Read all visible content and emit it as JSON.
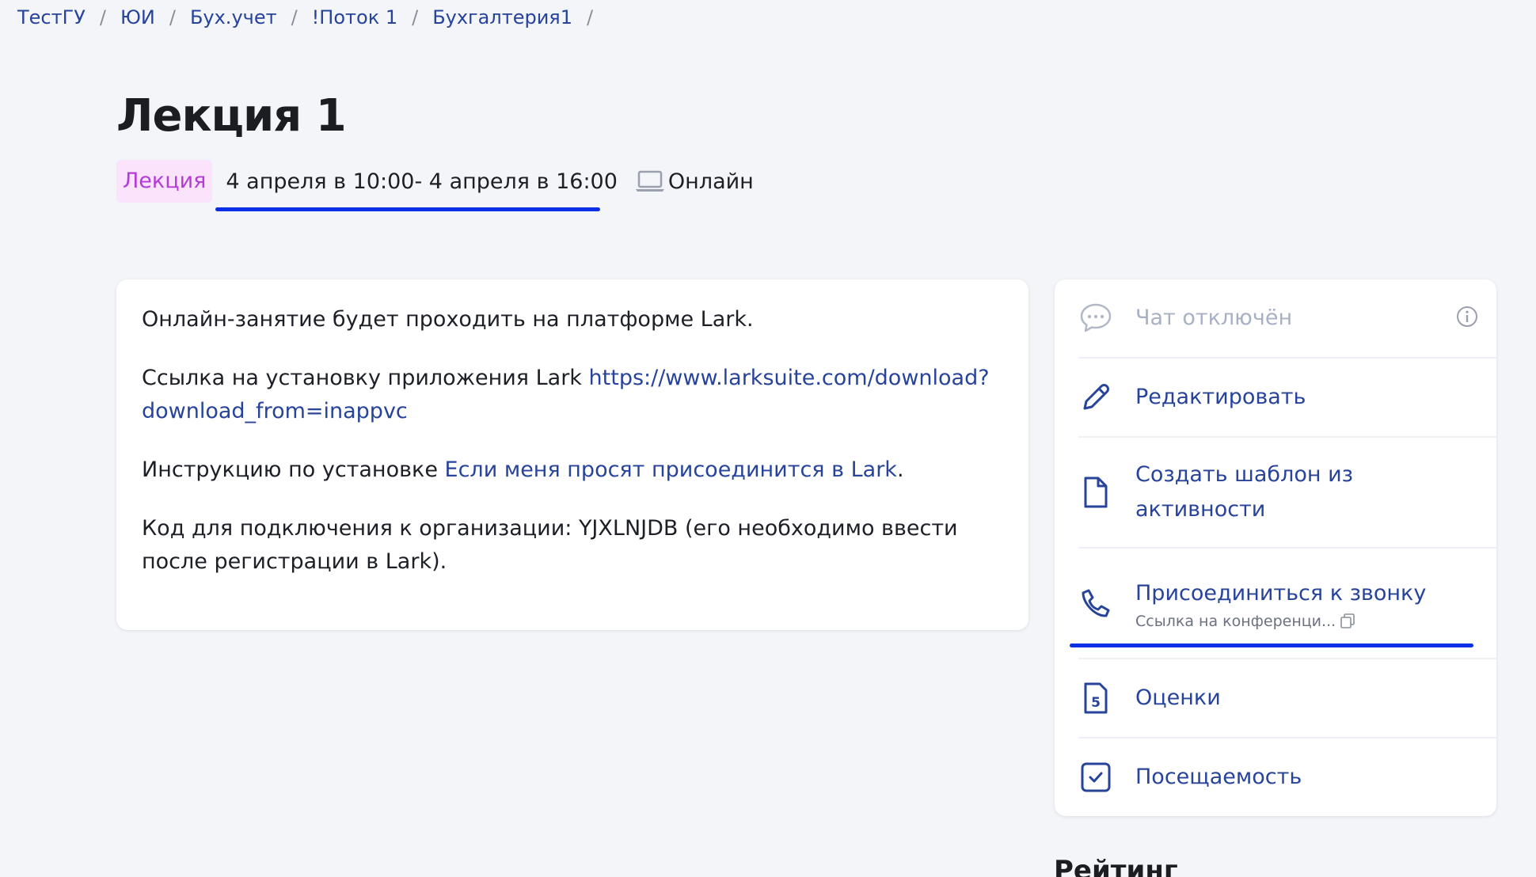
{
  "breadcrumb": [
    "ТестГУ",
    "ЮИ",
    "Бух.учет",
    "!Поток 1",
    "Бухгалтерия1"
  ],
  "breadcrumb_separator": "/",
  "page": {
    "title": "Лекция 1",
    "type_badge": "Лекция",
    "dates": "4 апреля в 10:00- 4 апреля в 16:00",
    "format": "Онлайн"
  },
  "description": {
    "p1": "Онлайн-занятие будет проходить на платформе Lark.",
    "p2_text": "Ссылка на установку приложения Lark ",
    "p2_link": "https://www.larksuite.com/download?download_from=inappvc",
    "p3_text": "Инструкцию по установке ",
    "p3_link": "Если меня просят присоединится в Lark",
    "p3_end": ".",
    "p4": "Код для подключения к организации: YJXLNJDB (его необходимо ввести после регистрации в Lark)."
  },
  "actions": {
    "chat": "Чат отключён",
    "edit": "Редактировать",
    "template": "Создать шаблон из активности",
    "call": "Присоединиться к звонку",
    "call_sub": "Ссылка на конференци...",
    "grades": "Оценки",
    "attendance": "Посещаемость"
  },
  "rating_heading": "Рейтинг",
  "colors": {
    "link": "#27439a",
    "badge_bg": "#fae3fb",
    "badge_text": "#b43cd6",
    "annotation_underline": "#0a2fe6"
  },
  "icons": [
    "laptop-icon",
    "chat-bubble-icon",
    "info-icon",
    "pencil-icon",
    "file-icon",
    "phone-icon",
    "copy-icon",
    "grade-file-icon",
    "checkbox-icon"
  ]
}
